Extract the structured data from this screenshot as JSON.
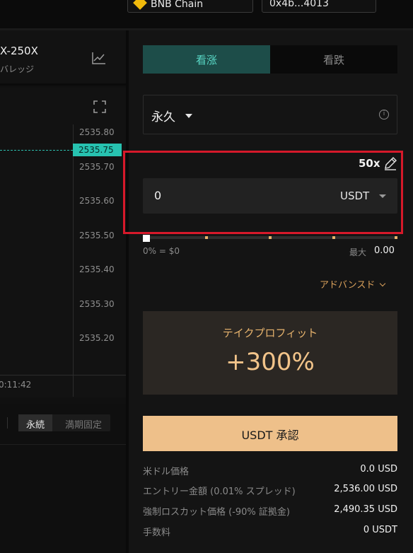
{
  "top": {
    "network_label": "BNB Chain",
    "wallet_label": "0x4b...4013"
  },
  "left": {
    "pair": "X-250X",
    "subtitle": "バレッジ",
    "y_ticks": [
      "2535.80",
      "2535.70",
      "2535.60",
      "2535.50",
      "2535.40",
      "2535.30",
      "2535.20"
    ],
    "current_price": "2535.75",
    "time_label": "0:11:42",
    "mode_toggle": {
      "active": "永続",
      "inactive": "満期固定"
    }
  },
  "right": {
    "tabs": {
      "long": "看涨",
      "short": "看跌"
    },
    "product_type": "永久",
    "leverage": "50x",
    "amount": {
      "value": "0",
      "currency": "USDT"
    },
    "slider": {
      "level_percent": 0,
      "min_label": "0% = $0",
      "max_label": "最大",
      "max_value": "0.00"
    },
    "advanced_label": "アドバンスド",
    "take_profit": {
      "title": "テイクプロフィット",
      "value": "+300%"
    },
    "approve_button": "USDT 承認",
    "details": [
      {
        "label": "米ドル価格",
        "value": "0.0 USD"
      },
      {
        "label": "エントリー金額 (0.01% スプレッド)",
        "value": "2,536.00 USD"
      },
      {
        "label": "強制ロスカット価格 (-90% 証拠金)",
        "value": "2,490.35 USD"
      },
      {
        "label": "手数料",
        "value": "0 USDT"
      }
    ]
  },
  "colors": {
    "accent_teal": "#27c2b0",
    "accent_gold": "#eec08a",
    "highlight_red": "#d6192a"
  }
}
